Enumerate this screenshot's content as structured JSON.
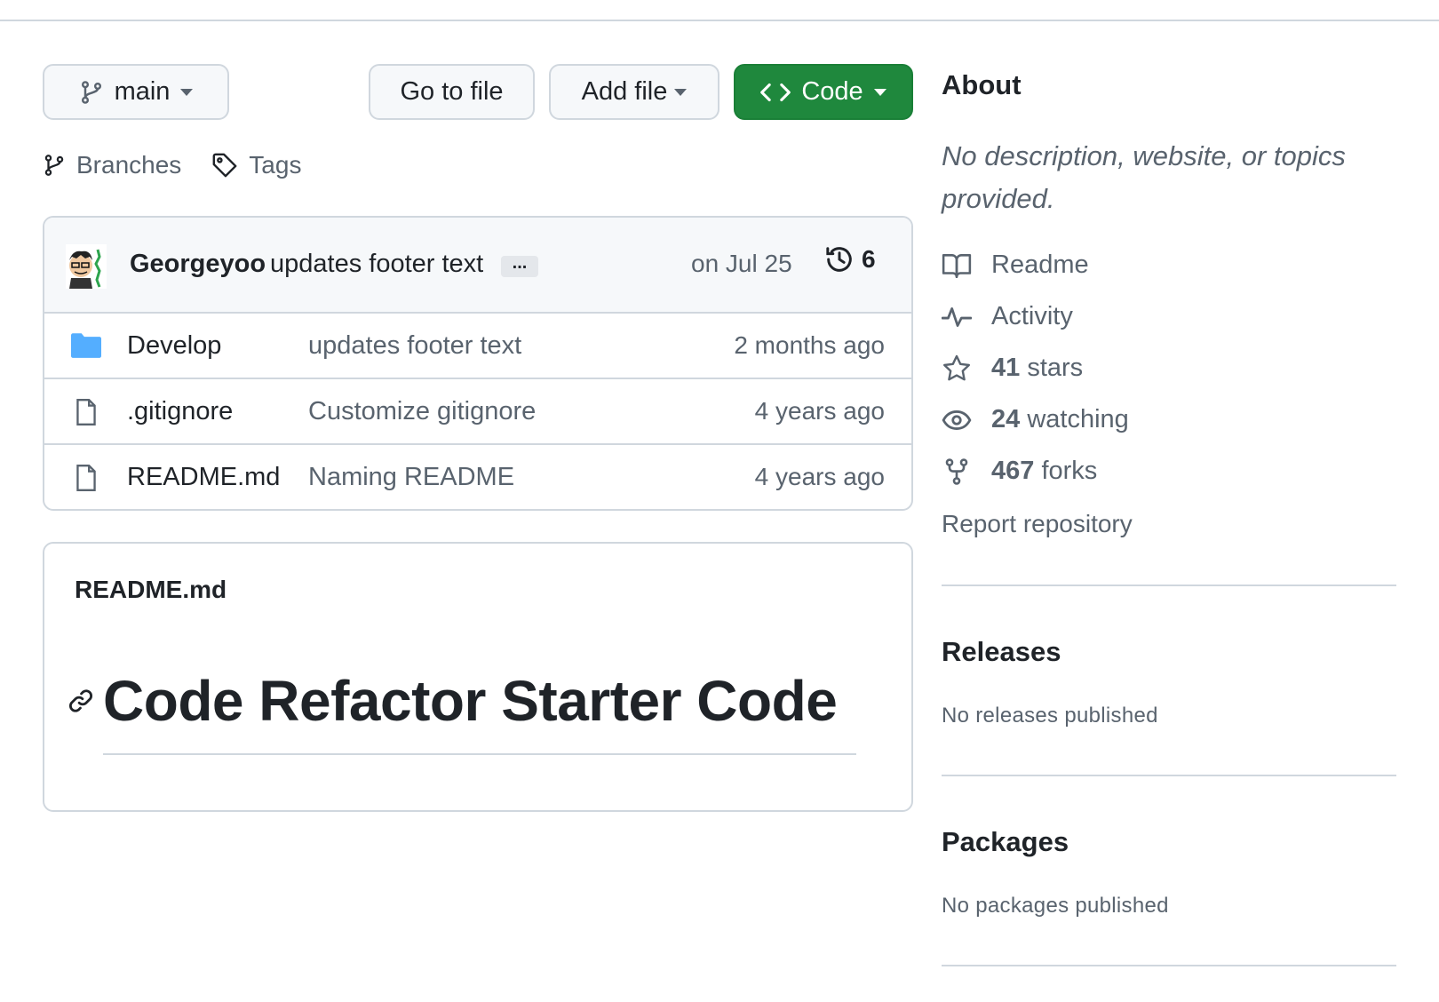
{
  "toolbar": {
    "branch": "main",
    "go_to_file": "Go to file",
    "add_file": "Add file",
    "code": "Code",
    "code_color": "#1f883d"
  },
  "links": {
    "branches": "Branches",
    "tags": "Tags"
  },
  "latest_commit": {
    "author": "Georgeyoo",
    "message": "updates footer text",
    "ellipsis": "...",
    "date": "on Jul 25",
    "commit_count": "6"
  },
  "files": [
    {
      "type": "folder",
      "name": "Develop",
      "message": "updates footer text",
      "date": "2 months ago"
    },
    {
      "type": "file",
      "name": ".gitignore",
      "message": "Customize gitignore",
      "date": "4 years ago"
    },
    {
      "type": "file",
      "name": "README.md",
      "message": "Naming README",
      "date": "4 years ago"
    }
  ],
  "readme": {
    "title": "README.md",
    "heading": "Code Refactor Starter Code"
  },
  "about": {
    "heading": "About",
    "description": "No description, website, or topics provided.",
    "readme": "Readme",
    "activity": "Activity",
    "stars_count": "41",
    "stars_label": "stars",
    "watching_count": "24",
    "watching_label": "watching",
    "forks_count": "467",
    "forks_label": "forks",
    "report": "Report repository"
  },
  "releases": {
    "heading": "Releases",
    "note": "No releases published"
  },
  "packages": {
    "heading": "Packages",
    "note": "No packages published"
  }
}
